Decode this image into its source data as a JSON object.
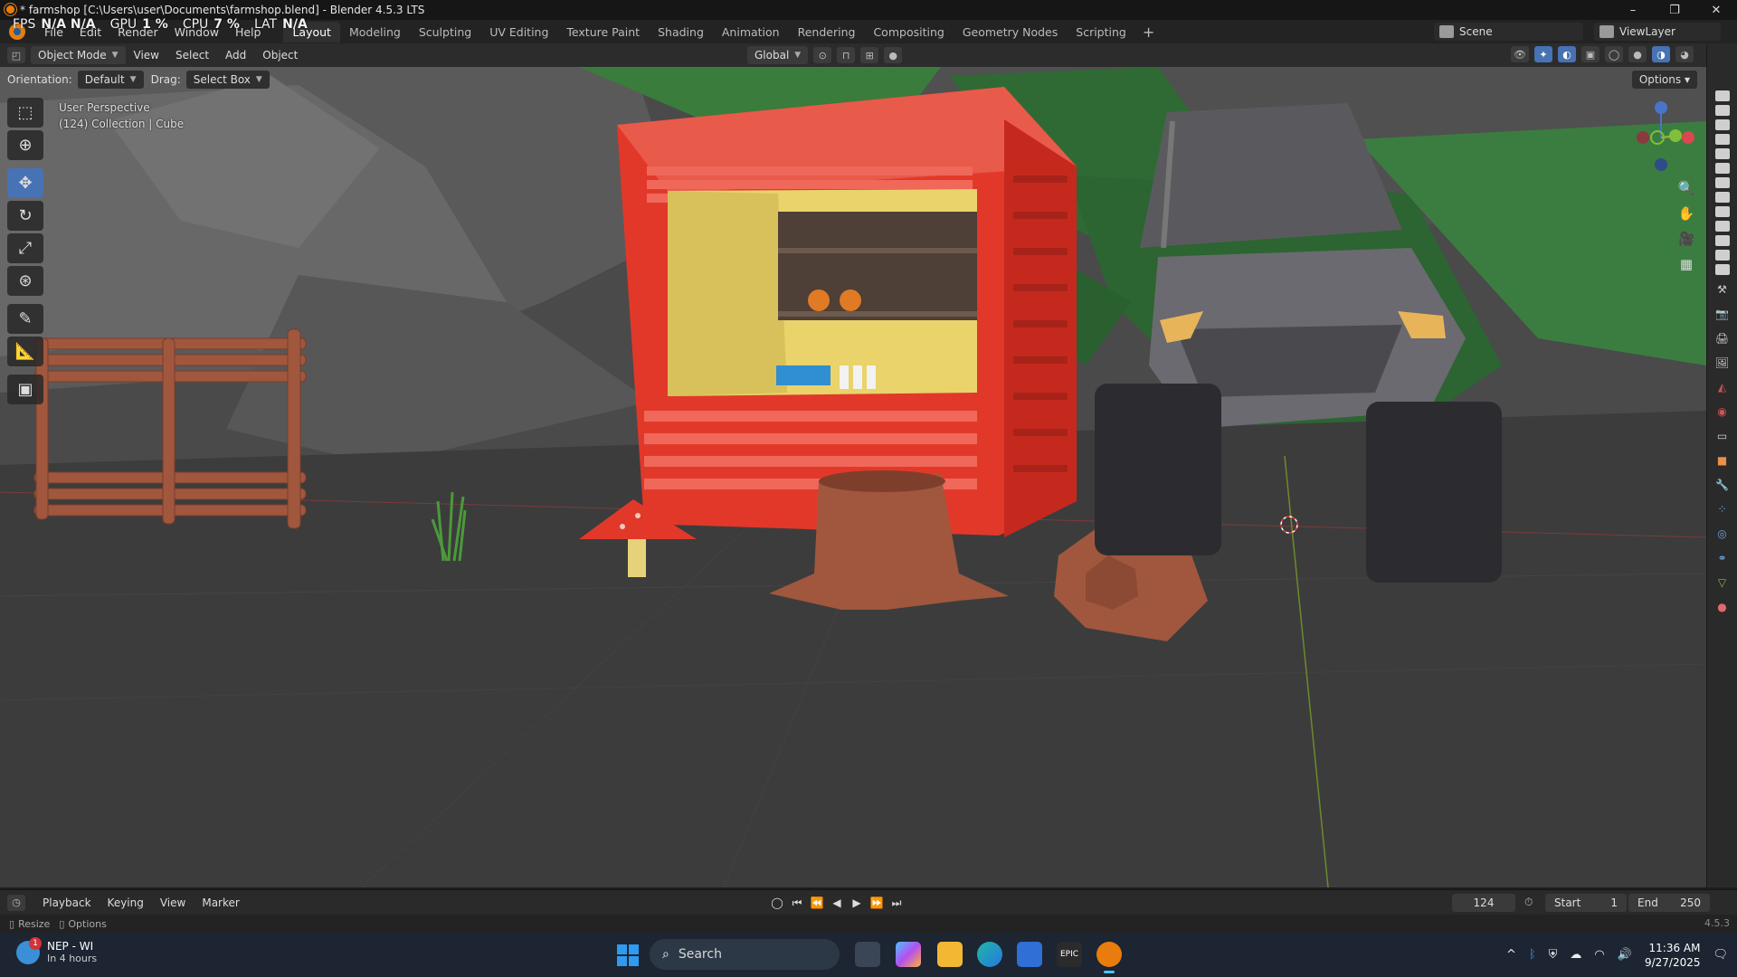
{
  "window": {
    "title": "* farmshop [C:\\Users\\user\\Documents\\farmshop.blend] - Blender 4.5.3 LTS",
    "controls": [
      "–",
      "❐",
      "✕"
    ]
  },
  "perf": {
    "fps_label": "FPS",
    "fps_value": "N/A N/A",
    "gpu_label": "GPU",
    "gpu_value": "1 %",
    "cpu_label": "CPU",
    "cpu_value": "7 %",
    "lat_label": "LAT",
    "lat_value": "N/A"
  },
  "menubar": {
    "items": [
      "File",
      "Edit",
      "Render",
      "Window",
      "Help"
    ],
    "workspaces": [
      "Layout",
      "Modeling",
      "Sculpting",
      "UV Editing",
      "Texture Paint",
      "Shading",
      "Animation",
      "Rendering",
      "Compositing",
      "Geometry Nodes",
      "Scripting"
    ],
    "active_workspace": "Layout",
    "add_tab": "+",
    "scene": "Scene",
    "view_layer": "ViewLayer"
  },
  "viewport_header": {
    "mode": "Object Mode",
    "menus": [
      "View",
      "Select",
      "Add",
      "Object"
    ],
    "transform_orientation": "Global"
  },
  "tool_header": {
    "orientation_label": "Orientation:",
    "orientation_value": "Default",
    "drag_label": "Drag:",
    "drag_value": "Select Box",
    "options": "Options"
  },
  "viewport": {
    "view_name": "User Perspective",
    "collection_info": "(124) Collection | Cube"
  },
  "tools": [
    "select-box",
    "cursor",
    "move",
    "rotate",
    "scale",
    "transform",
    "annotate",
    "measure",
    "add-cube"
  ],
  "active_tool": "move",
  "timeline": {
    "menus": [
      "Playback",
      "Keying",
      "View",
      "Marker"
    ],
    "current_frame": "124",
    "start_label": "Start",
    "start_value": "1",
    "end_label": "End",
    "end_value": "250"
  },
  "statusbar": {
    "resize": "Resize",
    "options": "Options",
    "version": "4.5.3"
  },
  "taskbar": {
    "weather_title": "NEP - WI",
    "weather_sub": "In 4 hours",
    "weather_badge": "1",
    "search_placeholder": "Search",
    "time": "11:36 AM",
    "date": "9/27/2025"
  },
  "colors": {
    "accent": "#4772b3",
    "blender_orange": "#e87d0d",
    "shop_red": "#e2382a",
    "shop_yellow": "#e9d36a",
    "wood": "#a0573e",
    "ground": "#3b3b3b"
  }
}
